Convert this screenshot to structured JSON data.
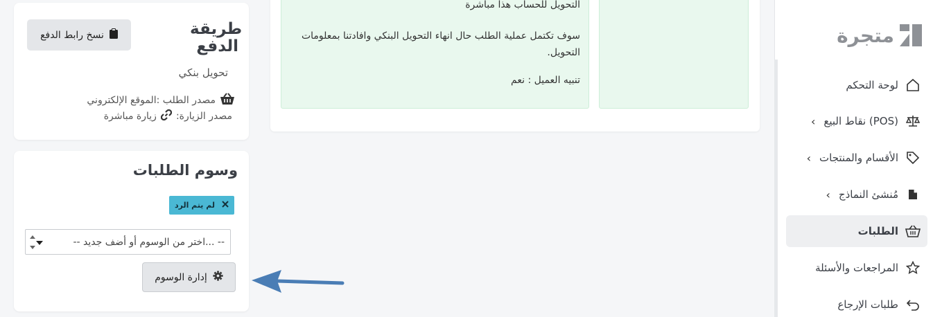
{
  "brand": {
    "name": "متجرة"
  },
  "sidebar": {
    "items": [
      {
        "label": "لوحة التحكم",
        "icon": "home-icon",
        "chevron": false,
        "active": false
      },
      {
        "label": "نقاط البيع (POS)",
        "icon": "scale-icon",
        "chevron": true,
        "active": false
      },
      {
        "label": "الأقسام والمنتجات",
        "icon": "tag-icon",
        "chevron": true,
        "active": false
      },
      {
        "label": "مُنشئ النماذج",
        "icon": "file-icon",
        "chevron": true,
        "active": false
      },
      {
        "label": "الطلبات",
        "icon": "basket-icon",
        "chevron": false,
        "active": true
      },
      {
        "label": "المراجعات والأسئلة",
        "icon": "star-icon",
        "chevron": false,
        "active": false
      },
      {
        "label": "طلبات الإرجاع",
        "icon": "undo-icon",
        "chevron": false,
        "active": false
      }
    ]
  },
  "transfer_note": {
    "line1": "التحويل للحساب هذا مباشرة",
    "line2": "سوف تكتمل عملية الطلب حال انهاء التحويل البنكي وافادتنا بمعلومات التحويل.",
    "line3": "تنبيه العميل : نعم"
  },
  "payment": {
    "title": "طريقة الدفع",
    "copy_button": "نسخ رابط الدفع",
    "method": "تحويل بنكي",
    "order_source": "مصدر الطلب :الموقع الإلكتروني",
    "visit_source_label": "مصدر الزيارة:",
    "visit_source_value": "زيارة مباشرة"
  },
  "tags": {
    "title": "وسوم الطلبات",
    "badge": "لم يتم الرد",
    "select_placeholder": "-- اختر من الوسوم أو أضف جديد... --",
    "manage_button": "إدارة الوسوم"
  },
  "colors": {
    "badge": "#4ab8d4",
    "note_bg": "#e9f8ee",
    "arrow": "#4a7db5",
    "active_nav": "#eeeff1"
  }
}
